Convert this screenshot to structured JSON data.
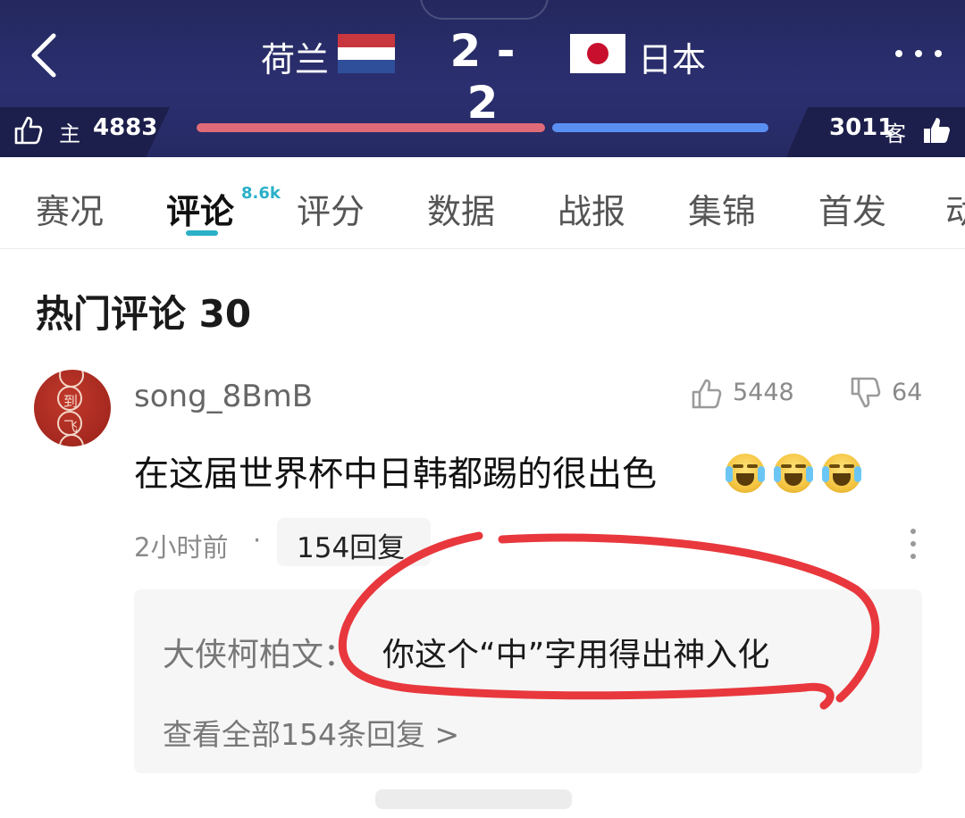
{
  "header": {
    "home_team": "荷兰",
    "away_team": "日本",
    "score": "2 - 2",
    "home_label": "主",
    "away_label": "客",
    "home_votes": "4883",
    "away_votes": "3011",
    "home_color": "#e06b78",
    "away_color": "#5a8ff2",
    "home_vote_share": 0.62,
    "icons": {
      "back": "chevron-left-icon",
      "more": "more-dots-icon",
      "thumbs": "thumbs-up-icon"
    }
  },
  "tabs": [
    {
      "label": "赛况"
    },
    {
      "label": "评论",
      "badge": "8.6k",
      "active": true
    },
    {
      "label": "评分"
    },
    {
      "label": "数据"
    },
    {
      "label": "战报"
    },
    {
      "label": "集锦"
    },
    {
      "label": "首发"
    },
    {
      "label": "动"
    }
  ],
  "accent_color": "#2bb0c8",
  "section": {
    "title": "热门评论 30"
  },
  "comment": {
    "username": "song_8BmB",
    "avatar_chars": [
      "到",
      "飞"
    ],
    "likes": "5448",
    "dislikes": "64",
    "text": "在这届世界杯中日韩都踢的很出色",
    "emoji": "crying-laugh-emoji",
    "time": "2小时前",
    "separator": "·",
    "reply_count_label": "154回复",
    "reply": {
      "author": "大侠柯柏文：",
      "text": "你这个“中”字用得出神入化"
    },
    "view_all": "查看全部154条回复 >"
  },
  "annotation_color": "#e8383d"
}
